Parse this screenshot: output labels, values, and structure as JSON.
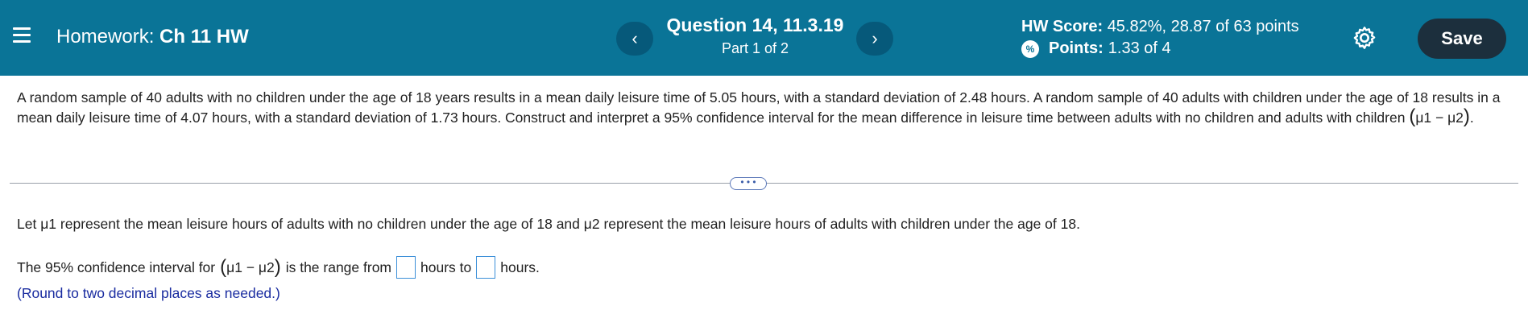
{
  "header": {
    "homework_label": "Homework:",
    "homework_name": "Ch 11 HW",
    "prev_label": "‹",
    "next_label": "›",
    "question_title": "Question 14, 11.3.19",
    "question_part": "Part 1 of 2",
    "hw_score_label": "HW Score:",
    "hw_score_value": "45.82%, 28.87 of 63 points",
    "points_label": "Points:",
    "points_value": "1.33 of 4",
    "save_label": "Save"
  },
  "problem": {
    "text": "A random sample of 40 adults with no children under the age of 18 years results in a mean daily leisure time of 5.05 hours, with a standard deviation of 2.48 hours. A random sample of 40 adults with children under the age of 18 results in a mean daily leisure time of 4.07 hours, with a standard deviation of 1.73 hours. Construct and interpret a 95% confidence interval for the mean difference in leisure time between adults with no children and adults with children",
    "expr": "μ1 − μ2",
    "end": "."
  },
  "expand_label": "• • •",
  "let": {
    "pre": "Let",
    "mu1": "μ1",
    "mid": "represent the mean leisure hours of adults with no children under the age of 18 and",
    "mu2": "μ2",
    "post": "represent the mean leisure hours of adults with children under the age of 18."
  },
  "ci": {
    "pre": "The 95% confidence interval for",
    "expr": "μ1 − μ2",
    "mid": "is the range from",
    "between": "hours to",
    "post": "hours."
  },
  "note": "(Round to two decimal places as needed.)"
}
